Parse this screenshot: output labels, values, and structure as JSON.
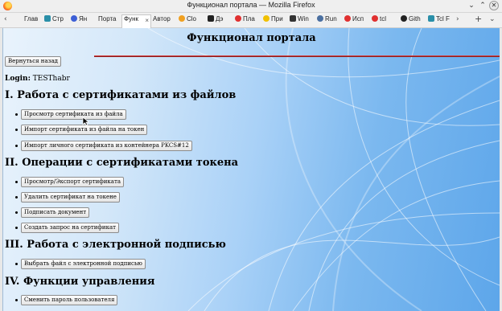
{
  "window": {
    "title": "Функционал портала — Mozilla Firefox",
    "minimize": "⌄",
    "maximize": "⌃",
    "close": "✕"
  },
  "tabs": {
    "nav_left": "‹",
    "nav_right": "›",
    "new_tab": "+",
    "list_all": "⌄",
    "close_active": "×",
    "items": [
      {
        "label": "Глав",
        "color": "#888888"
      },
      {
        "label": "Стр",
        "color": "#2a8fa8"
      },
      {
        "label": "Ян",
        "color": "#3d5fd6"
      },
      {
        "label": "Порта",
        "color": ""
      },
      {
        "label": "Функ",
        "color": ""
      },
      {
        "label": "Автор",
        "color": ""
      },
      {
        "label": "Clo",
        "color": "#f0a020"
      },
      {
        "label": "Дэ",
        "color": "#222222"
      },
      {
        "label": "Пла",
        "color": "#e03030"
      },
      {
        "label": "При",
        "color": "#f0c000"
      },
      {
        "label": "Win",
        "color": "#333333"
      },
      {
        "label": "Run",
        "color": "#4a6fa0"
      },
      {
        "label": "Исп",
        "color": "#e03030"
      },
      {
        "label": "tcl",
        "color": "#e03030"
      },
      {
        "label": "Gith",
        "color": "#222222"
      },
      {
        "label": "Tcl F",
        "color": "#2a8fa8"
      }
    ]
  },
  "page": {
    "title": "Функционал портала",
    "back_button": "Вернуться назад",
    "login_label": "Login:",
    "login_value": "TESThabr"
  },
  "sections": [
    {
      "heading": "I. Работа с сертификатами из файлов",
      "buttons": [
        "Просмотр сертификата из файла",
        "Импорт сертификата из файла на токен",
        "Импорт личного сертификата из контейнера PKCS#12"
      ]
    },
    {
      "heading": "II. Операции с сертификатами токена",
      "buttons": [
        "Просмотр/Экспорт сертификата",
        "Удалить сертификат на токене",
        "Подписать документ",
        "Создать запрос на сертификат"
      ]
    },
    {
      "heading": "III. Работа с электронной подписью",
      "buttons": [
        "Выбрать файл с электронной подписью"
      ]
    },
    {
      "heading": "IV. Функции управления",
      "buttons": [
        "Сменить пароль пользователя"
      ]
    }
  ]
}
